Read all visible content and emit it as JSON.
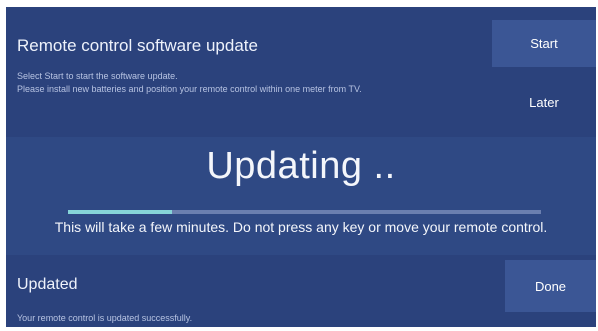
{
  "top_dialog": {
    "title": "Remote control software update",
    "description_line1": "Select Start to start the software update.",
    "description_line2": "Please install new batteries and position your remote control within one meter from TV.",
    "start_label": "Start",
    "later_label": "Later"
  },
  "update_overlay": {
    "headline": "Updating ..",
    "progress": 0.22,
    "message": "This will take a few minutes. Do not press any key or move your remote control."
  },
  "bottom_dialog": {
    "title": "Updated",
    "description": "Your remote control is updated successfully.",
    "done_label": "Done"
  },
  "colors": {
    "dialog_background": "#2b427c",
    "overlay_background": "#2f4984",
    "button_focus": "#3b5695",
    "progress_fill": "#86d4d8",
    "progress_track": "#6b7faf"
  }
}
